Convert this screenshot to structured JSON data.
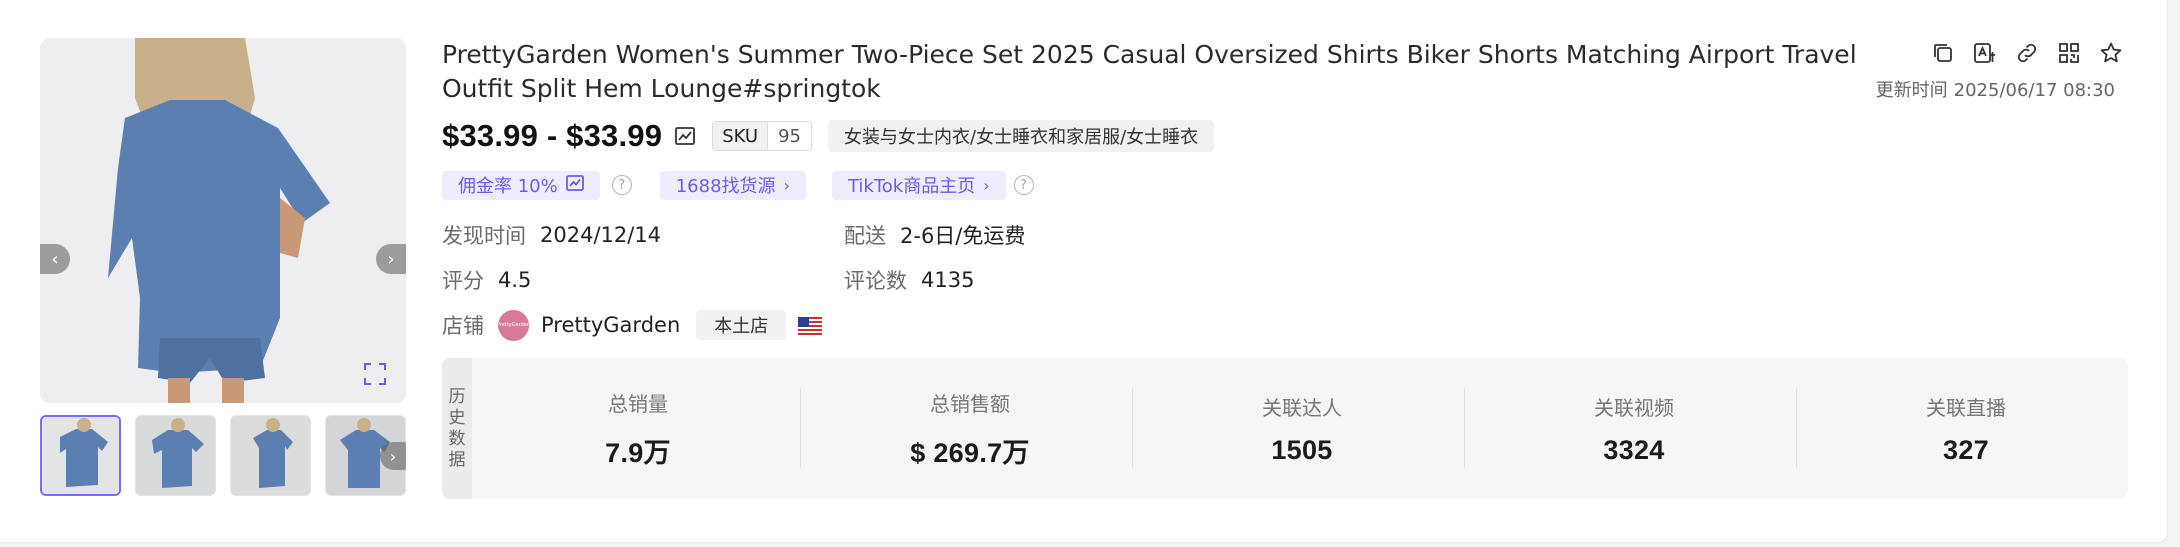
{
  "product": {
    "title": "PrettyGarden Women's Summer Two-Piece Set 2025 Casual Oversized Shirts Biker Shorts Matching Airport Travel Outfit Split Hem Lounge#springtok",
    "updated_label": "更新时间",
    "updated_value": "2025/06/17 08:30",
    "price": "$33.99 - $33.99",
    "sku_label": "SKU",
    "sku_value": "95",
    "category": "女装与女士内衣/女士睡衣和家居服/女士睡衣"
  },
  "tags": {
    "commission": "佣金率 10%",
    "source_1688": "1688找货源",
    "tiktok_home": "TikTok商品主页"
  },
  "details": {
    "discover_label": "发现时间",
    "discover_value": "2024/12/14",
    "shipping_label": "配送",
    "shipping_value": "2-6日/免运费",
    "rating_label": "评分",
    "rating_value": "4.5",
    "reviews_label": "评论数",
    "reviews_value": "4135",
    "store_label": "店铺",
    "store_name": "PrettyGarden",
    "store_tag": "本土店",
    "store_logo_text": "PrettyGarden"
  },
  "stats": {
    "section_label": [
      "历",
      "史",
      "数",
      "据"
    ],
    "items": [
      {
        "label": "总销量",
        "value": "7.9万"
      },
      {
        "label": "总销售额",
        "value": "$ 269.7万"
      },
      {
        "label": "关联达人",
        "value": "1505"
      },
      {
        "label": "关联视频",
        "value": "3324"
      },
      {
        "label": "关联直播",
        "value": "327"
      }
    ]
  },
  "icons": {
    "actions": [
      "copy-icon",
      "translate-icon",
      "link-icon",
      "qrcode-icon",
      "star-icon"
    ],
    "accent": "#6c5ce7",
    "product_color": "#5b7fb0"
  }
}
